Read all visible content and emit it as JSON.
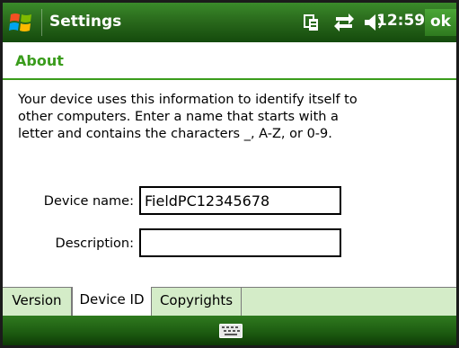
{
  "titlebar": {
    "title": "Settings",
    "clock": "12:59",
    "ok_label": "ok",
    "icons": [
      "windows-start-icon",
      "connectivity-icon",
      "sync-arrows-icon",
      "volume-icon"
    ]
  },
  "section": {
    "title": "About"
  },
  "description": "Your device uses this information to identify itself to other computers. Enter a name that starts with a letter and contains the characters _, A-Z, or 0-9.",
  "form": {
    "device_name_label": "Device name:",
    "device_name_value": "FieldPC12345678",
    "description_label": "Description:",
    "description_value": ""
  },
  "tabs": [
    {
      "label": "Version",
      "active": false
    },
    {
      "label": "Device ID",
      "active": true
    },
    {
      "label": "Copyrights",
      "active": false
    }
  ],
  "menubar": {
    "icon": "keyboard-icon"
  },
  "colors": {
    "accent": "#3a9c1c",
    "titlebar": "#2a6a1c",
    "tabbar": "#d4ecc8"
  }
}
